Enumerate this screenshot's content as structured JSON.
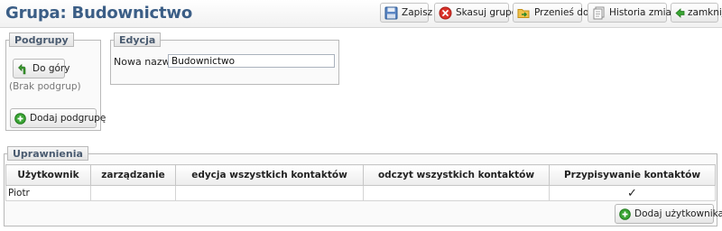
{
  "header": {
    "title": "Grupa: Budownictwo",
    "buttons": {
      "save": "Zapisz",
      "delete": "Skasuj grupę",
      "move": "Przenieś do",
      "history": "Historia zmian",
      "close": "zamknij"
    }
  },
  "subgroups": {
    "legend": "Podgrupy",
    "up_label": "Do góry",
    "empty_text": "(Brak podgrup)",
    "add_label": "Dodaj podgrupę"
  },
  "edit": {
    "legend": "Edycja",
    "name_label": "Nowa nazwa:",
    "name_value": "Budownictwo"
  },
  "permissions": {
    "legend": "Uprawnienia",
    "columns": [
      "Użytkownik",
      "zarządzanie",
      "edycja wszystkich kontaktów",
      "odczyt wszystkich kontaktów",
      "Przypisywanie kontaktów"
    ],
    "rows": [
      {
        "user": "Piotr",
        "manage": "",
        "edit_all": "",
        "read_all": "",
        "assign": "✓"
      }
    ],
    "add_user_label": "Dodaj użytkownika"
  },
  "colors": {
    "title": "#3b5e86",
    "legend_text": "#4a5b70",
    "add_icon": "#3aa534",
    "delete_icon": "#d9332b",
    "up_icon": "#3a9a2e"
  }
}
